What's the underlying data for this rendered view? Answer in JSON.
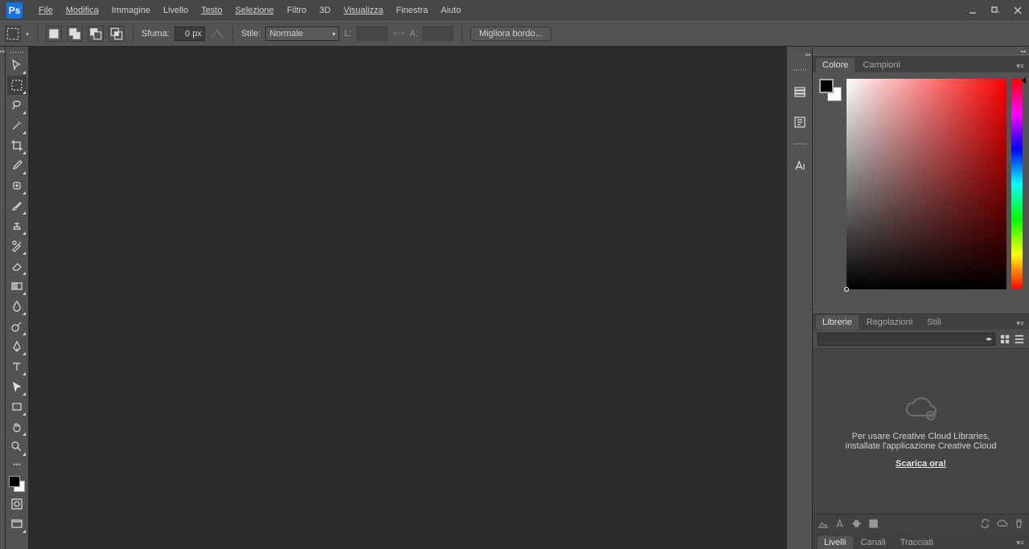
{
  "menubar": {
    "items": [
      "File",
      "Modifica",
      "Immagine",
      "Livello",
      "Testo",
      "Selezione",
      "Filtro",
      "3D",
      "Visualizza",
      "Finestra",
      "Aiuto"
    ]
  },
  "optionsbar": {
    "sfuma_label": "Sfuma:",
    "sfuma_value": "0 px",
    "stile_label": "Stile:",
    "stile_value": "Normale",
    "l_label": "L:",
    "a_label": "A:",
    "refine": "Migliora bordo..."
  },
  "panels": {
    "colore_tabs": [
      "Colore",
      "Campioni"
    ],
    "librerie_tabs": [
      "Librerie",
      "Regolazioni",
      "Stili"
    ],
    "librerie_msg_line1": "Per usare Creative Cloud Libraries,",
    "librerie_msg_line2": "installate l'applicazione Creative Cloud",
    "librerie_link": "Scarica ora!",
    "layers_tabs": [
      "Livelli",
      "Canali",
      "Tracciati"
    ]
  }
}
